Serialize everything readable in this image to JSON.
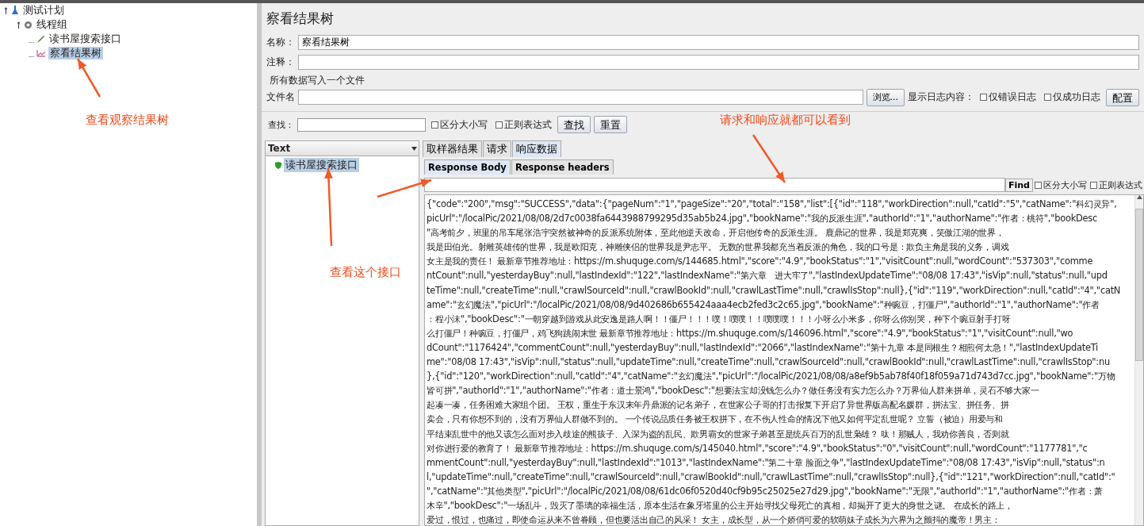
{
  "tree": [
    {
      "label": "测试计划",
      "kind": "plan",
      "selected": false,
      "children": [
        {
          "label": "线程组",
          "kind": "group",
          "selected": false,
          "children": [
            {
              "label": "读书屋搜索接口",
              "kind": "sampler",
              "selected": false
            },
            {
              "label": "察看结果树",
              "kind": "listener",
              "selected": true
            }
          ]
        }
      ]
    }
  ],
  "panel": {
    "title": "察看结果树",
    "name_label": "名称：",
    "name_value": "察看结果树",
    "comment_label": "注释：",
    "file_section": "所有数据写入一个文件",
    "file_label": "文件名",
    "browse_button": "浏览...",
    "log_label": "显示日志内容：",
    "log_options": [
      {
        "label": "仅错误日志",
        "checked": false
      },
      {
        "label": "仅成功日志",
        "checked": false
      }
    ],
    "config_button": "配置"
  },
  "search": {
    "label": "查找：",
    "options": [
      {
        "label": "区分大小写",
        "checked": false
      },
      {
        "label": "正则表达式",
        "checked": false
      }
    ],
    "buttons": [
      "查找",
      "重置"
    ]
  },
  "results": {
    "renderer": "Text",
    "items": [
      {
        "label": "读书屋搜索接口",
        "selected": true,
        "color": "#2e9a2e"
      }
    ]
  },
  "tabs": [
    {
      "label": "取样器结果",
      "selected": false
    },
    {
      "label": "请求",
      "selected": false
    },
    {
      "label": "响应数据",
      "selected": true
    }
  ],
  "subtabs": [
    {
      "label": "Response Body",
      "selected": true
    },
    {
      "label": "Response headers",
      "selected": false
    }
  ],
  "body_search": {
    "button": "Find",
    "options": [
      {
        "label": "区分大小写",
        "checked": false
      },
      {
        "label": "正则表达式",
        "checked": false
      }
    ]
  },
  "body_lines": [
    "{\"code\":\"200\",\"msg\":\"SUCCESS\",\"data\":{\"pageNum\":\"1\",\"pageSize\":\"20\",\"total\":\"158\",\"list\":[{\"id\":\"118\",\"workDirection\":null,\"catId\":\"5\",\"catName\":\"科幻灵异\",",
    "picUrl\":\"/localPic/2021/08/08/2d7c0038fa6443988799295d35ab5b24.jpg\",\"bookName\":\"我的反派生涯\",\"authorId\":\"1\",\"authorName\":\"作者：桃符\",\"bookDesc",
    "\"高考前夕，班里的吊车尾张浩宇突然被神奇的反派系统附体，至此他逆天改命，开启他传奇的反派生涯。 鹿鼎记的世界，我是郑克爽，笑傲江湖的世界，",
    "我是田伯光。射雕英雄传的世界，我是欧阳克，神雕侠侣的世界我是尹志平。 无数的世界我都充当着反派的角色，我的口号是：欺负主角是我的义务，调戏",
    "女主是我的责任！ 最新章节推荐地址：https://m.shuquge.com/s/144685.html\",\"score\":\"4.9\",\"bookStatus\":\"1\",\"visitCount\":null,\"wordCount\":\"537303\",\"comme",
    "ntCount\":null,\"yesterdayBuy\":null,\"lastIndexId\":\"122\",\"lastIndexName\":\"第六章　进大牢了\",\"lastIndexUpdateTime\":\"08/08 17:43\",\"isVip\":null,\"status\":null,\"upd",
    "teTime\":null,\"createTime\":null,\"crawlSourceId\":null,\"crawlBookId\":null,\"crawlLastTime\":null,\"crawlIsStop\":null},{\"id\":\"119\",\"workDirection\":null,\"catId\":\"4\",\"catN",
    "ame\":\"玄幻魔法\",\"picUrl\":\"/localPic/2021/08/08/9d402686b655424aaa4ecb2fed3c2c65.jpg\",\"bookName\":\"种豌豆，打僵尸\",\"authorId\":\"1\",\"authorName\":\"作者",
    "：程小沫\",\"bookDesc\":\"一朝穿越到游戏从此安逸是路人啊！！僵尸！！！噗！噗噗！！噗噗噗！！！小呀么小米多，你呀么你别哭，种下个豌豆射手打呀",
    "么打僵尸！种豌豆，打僵尸，鸡飞狗跳闹末世 最新章节推荐地址：https://m.shuquge.com/s/146096.html\",\"score\":\"4.9\",\"bookStatus\":\"1\",\"visitCount\":null,\"wo",
    "dCount\":\"1176424\",\"commentCount\":null,\"yesterdayBuy\":null,\"lastIndexId\":\"2066\",\"lastIndexName\":\"第十九章 本是同根生？相煎何太急！\",\"lastIndexUpdateTi",
    "me\":\"08/08 17:43\",\"isVip\":null,\"status\":null,\"updateTime\":null,\"createTime\":null,\"crawlSourceId\":null,\"crawlBookId\":null,\"crawlLastTime\":null,\"crawlIsStop\":nu",
    "},{\"id\":\"120\",\"workDirection\":null,\"catId\":\"4\",\"catName\":\"玄幻魔法\",\"picUrl\":\"/localPic/2021/08/08/a8ef9b5ab78f40f18f059a71d743d7cc.jpg\",\"bookName\":\"万物",
    "皆可拼\",\"authorId\":\"1\",\"authorName\":\"作者：道士景鸿\",\"bookDesc\":\"想要法宝却没钱怎么办？做任务没有实力怎么办？万界仙人群来拼单，灵石不够大家一",
    "起凑一凑，任务困难大家组个团。 王权，重生于东汉末年丹鼎派的记名弟子，在世家公子哥的打击报复下开启了异世界版高配名媛群，拼法宝、拼任务、拼",
    "卖会，只有你想不到的，没有万界仙人群做不到的。 一个传说品质任务被王权拼下，在不伤人性命的情况下他又如何平定乱世呢？ 立誓（被迫）用爱与和",
    "平结束乱世中的他又该怎么面对步入歧途的熊孩子、入深为盗的乱民、欺男霸女的世家子弟甚至是统兵百万的乱世枭雄？ 呔！那贼人，我劝你善良，否则就",
    "对你进行爱的教育了！ 最新章节推荐地址：https://m.shuquge.com/s/145040.html\",\"score\":\"4.9\",\"bookStatus\":\"0\",\"visitCount\":null,\"wordCount\":\"1177781\",\"c",
    "mmentCount\":null,\"yesterdayBuy\":null,\"lastIndexId\":\"1013\",\"lastIndexName\":\"第二十章 脸面之争\",\"lastIndexUpdateTime\":\"08/08 17:43\",\"isVip\":null,\"status\":n",
    "l,\"updateTime\":null,\"createTime\":null,\"crawlSourceId\":null,\"crawlBookId\":null,\"crawlLastTime\":null,\"crawlIsStop\":null},{\"id\":\"121\",\"workDirection\":null,\"catId\":\"",
    "\",\"catName\":\"其他类型\",\"picUrl\":\"/localPic/2021/08/08/61dc06f0520d40cf9b95c25025e27d29.jpg\",\"bookName\":\"无限\",\"authorId\":\"1\",\"authorName\":\"作者：萧",
    "木辛\",\"bookDesc\":\"一场乱斗，毁灭了墨璃的幸福生活，原本生活在象牙塔里的公主开始寻找父母死亡的真相，却揭开了更大的身世之谜。 在成长的路上，",
    "爱过，恨过，也痛过，即使命运从来不曾眷顾，但也要活出自己的风采！ 女主，成长型，从一个娇俏可爱的软萌妹子成长为六界为之颤抖的魔帝！男主："
  ],
  "annotations": [
    {
      "text": "查看观察结果树"
    },
    {
      "text": "查看这个接口"
    },
    {
      "text": "请求和响应就都可以看到"
    }
  ]
}
